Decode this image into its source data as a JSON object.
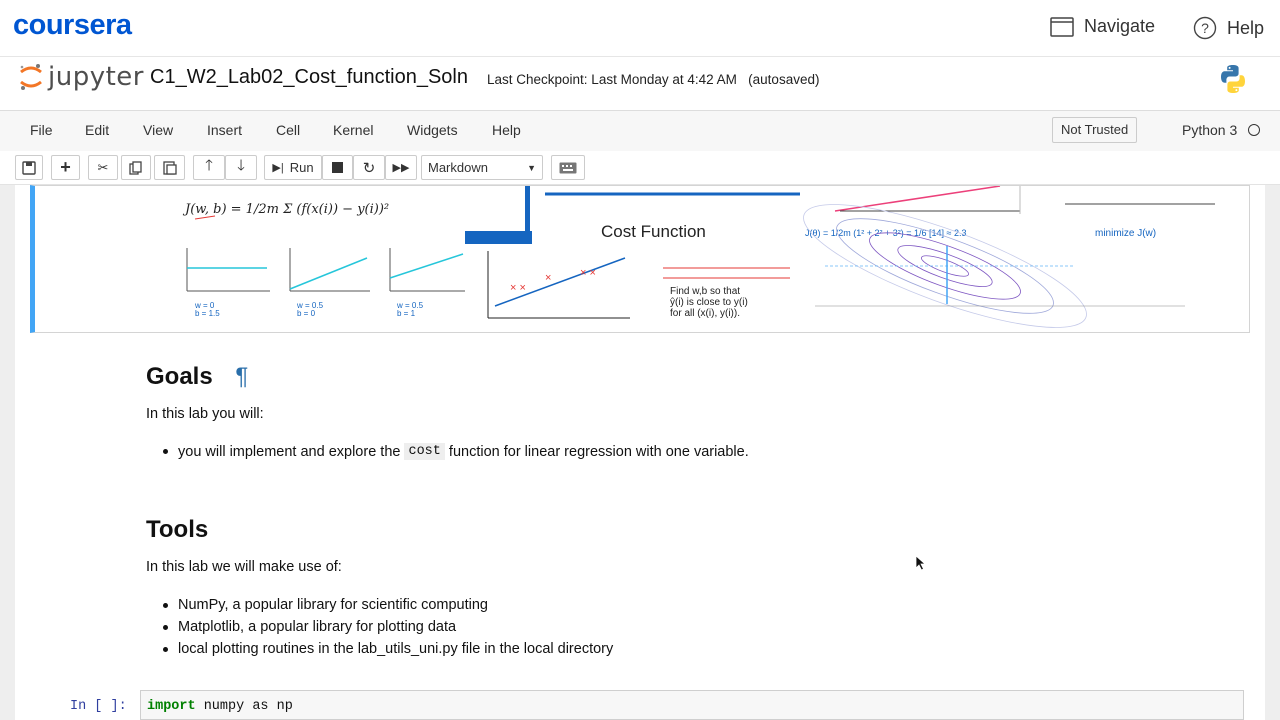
{
  "coursera": {
    "logo_text": "coursera",
    "navigate_label": "Navigate",
    "help_label": "Help"
  },
  "jupyter": {
    "logo_text": "jupyter",
    "notebook_title": "C1_W2_Lab02_Cost_function_Soln",
    "checkpoint": "Last Checkpoint: Last Monday at 4:42 AM",
    "autosaved": "(autosaved)"
  },
  "menu": {
    "items": [
      "File",
      "Edit",
      "View",
      "Insert",
      "Cell",
      "Kernel",
      "Widgets",
      "Help"
    ],
    "trust_status": "Not Trusted",
    "kernel": "Python 3"
  },
  "toolbar": {
    "run_label": "Run",
    "cell_type": "Markdown"
  },
  "banner": {
    "center_title": "Cost Function",
    "formula": "J(w,b) = 1/2m Σ (f(x(i)) − y(i))²",
    "find_text": [
      "Find w,b so that",
      "ŷ(i) is close to y(i)",
      "for all (x(i), y(i))."
    ],
    "minimize_text": "minimize J(w)",
    "panel_labels": [
      "w = 0",
      "b = 1.5",
      "w = 0.5",
      "b = 0",
      "w = 0.5",
      "b = 1"
    ]
  },
  "goals": {
    "heading": "Goals",
    "anchor": "¶",
    "intro": "In this lab you will:",
    "bullet_before": "you will implement and explore the",
    "bullet_code": "cost",
    "bullet_after": "function for linear regression with one variable."
  },
  "tools": {
    "heading": "Tools",
    "intro": "In this lab we will make use of:",
    "items": [
      "NumPy, a popular library for scientific computing",
      "Matplotlib, a popular library for plotting data",
      "local plotting routines in the lab_utils_uni.py file in the local directory"
    ]
  },
  "code_cell": {
    "prompt": "In [ ]:",
    "keyword": "import",
    "code_rest": " numpy as np"
  },
  "colors": {
    "coursera_blue": "#0056d2",
    "cell_selected": "#42a5f5",
    "jupyter_orange": "#f37626"
  }
}
